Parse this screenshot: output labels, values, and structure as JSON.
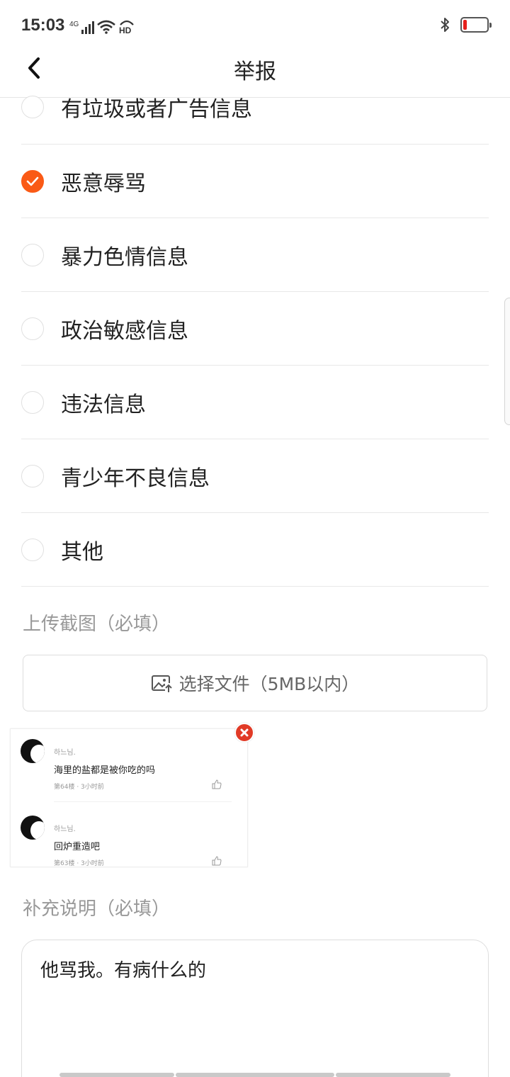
{
  "status_bar": {
    "time": "15:03",
    "network": "4G",
    "battery_level": 0.15,
    "battery_color": "#e6201c"
  },
  "nav": {
    "title": "举报",
    "back_icon": "chevron-left-icon"
  },
  "report_options": [
    {
      "label": "有垃圾或者广告信息",
      "checked": false
    },
    {
      "label": "恶意辱骂",
      "checked": true
    },
    {
      "label": "暴力色情信息",
      "checked": false
    },
    {
      "label": "政治敏感信息",
      "checked": false
    },
    {
      "label": "违法信息",
      "checked": false
    },
    {
      "label": "青少年不良信息",
      "checked": false
    },
    {
      "label": "其他",
      "checked": false
    }
  ],
  "upload": {
    "section_label": "上传截图（必填）",
    "button_label": "选择文件（5MB以内）",
    "icon": "image-upload-icon"
  },
  "screenshot": {
    "comments": [
      {
        "user": "하느님.",
        "text": "海里的盐都是被你吃的吗",
        "meta": "第64楼 · 3小时前"
      },
      {
        "user": "하느님.",
        "text": "回炉重造吧",
        "meta": "第63楼 · 3小时前"
      }
    ],
    "delete_icon": "close-circle-icon"
  },
  "description": {
    "section_label": "补充说明（必填）",
    "value": "他骂我。有病什么的"
  },
  "colors": {
    "accent": "#fa5a16",
    "muted_text": "#999999"
  }
}
